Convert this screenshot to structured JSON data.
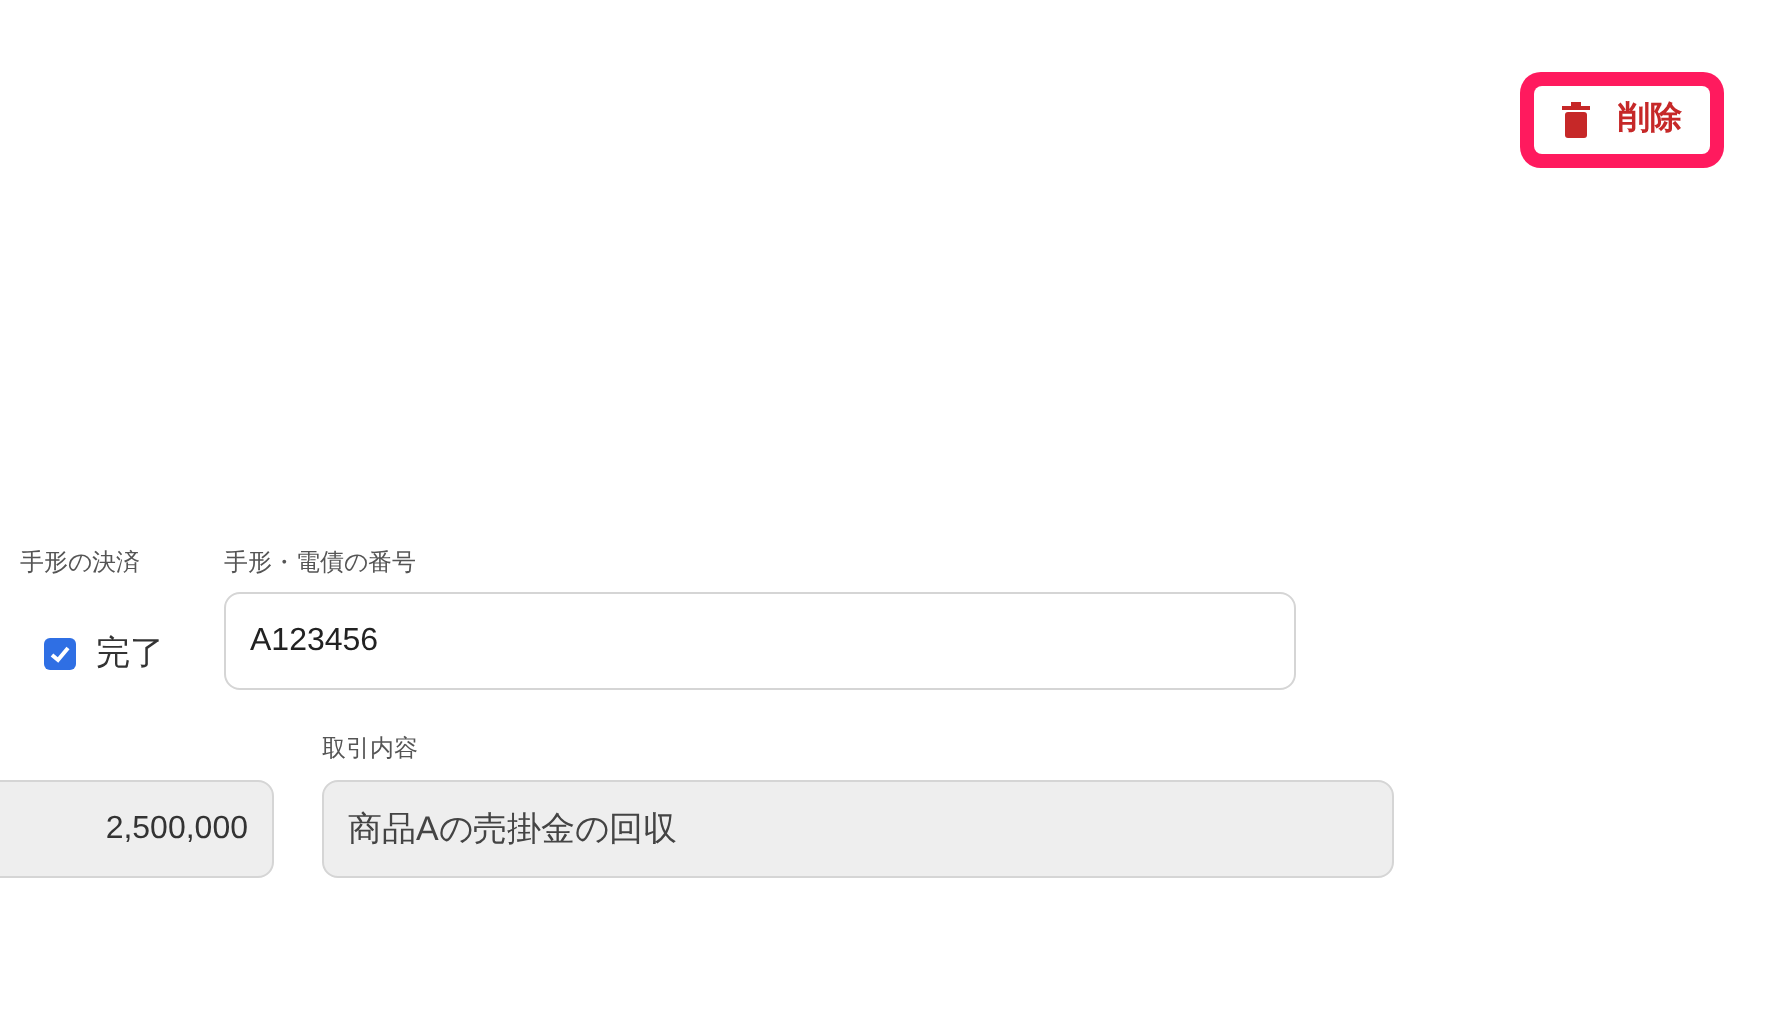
{
  "delete_button": {
    "label": "削除",
    "highlighted": true
  },
  "settlement": {
    "label": "手形の決済",
    "option_label": "完了",
    "checked": true
  },
  "bill_number": {
    "label": "手形・電債の番号",
    "value": "A123456",
    "disabled": false
  },
  "amount": {
    "value": "2,500,000",
    "disabled": true
  },
  "description": {
    "label": "取引内容",
    "value": "商品Aの売掛金の回収",
    "disabled": true
  }
}
